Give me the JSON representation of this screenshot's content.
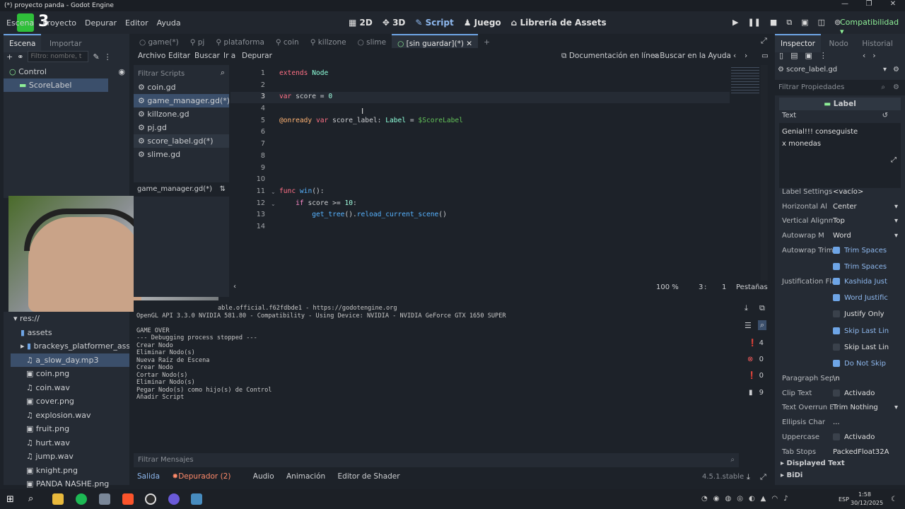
{
  "window": {
    "title": "(*) proyecto panda - Godot Engine"
  },
  "menu": {
    "items": [
      "Escena",
      "Proyecto",
      "Depurar",
      "Editor",
      "Ayuda"
    ],
    "logo_text": "3"
  },
  "workspaces": {
    "items": [
      "2D",
      "3D",
      "Script",
      "Juego",
      "Librería de Assets"
    ],
    "active": "Script"
  },
  "renderer": "Compatibilidad",
  "scene_dock": {
    "tabs": [
      "Escena",
      "Importar"
    ],
    "filter_placeholder": "Filtro: nombre, t",
    "nodes": [
      {
        "label": "Control"
      },
      {
        "label": "ScoreLabel"
      }
    ]
  },
  "editor_tabs": [
    "game(*)",
    "pj",
    "plataforma",
    "coin",
    "killzone",
    "slime",
    "[sin guardar](*)"
  ],
  "script_menu": {
    "items": [
      "Archivo",
      "Editar",
      "Buscar",
      "Ir a",
      "Depurar"
    ],
    "doc_button": "Documentación en línea",
    "help_search": "Buscar en la Ayuda"
  },
  "script_list": {
    "filter_placeholder": "Filtrar Scripts",
    "items": [
      "coin.gd",
      "game_manager.gd(*)",
      "killzone.gd",
      "pj.gd",
      "score_label.gd(*)",
      "slime.gd"
    ],
    "current": "game_manager.gd(*)"
  },
  "code": {
    "line_numbers": [
      "1",
      "2",
      "3",
      "4",
      "5",
      "6",
      "7",
      "8",
      "9",
      "10",
      "11",
      "12",
      "13",
      "14"
    ],
    "zoom": "100 %",
    "cursor_line": "3",
    "cursor_col": "1",
    "indent_mode": "Pestañas"
  },
  "filesystem": {
    "root": "res://",
    "items": [
      "assets",
      "brackeys_platformer_ass...",
      "a_slow_day.mp3",
      "coin.png",
      "coin.wav",
      "cover.png",
      "explosion.wav",
      "fruit.png",
      "hurt.wav",
      "jump.wav",
      "knight.png",
      "PANDA NASHE.png"
    ]
  },
  "output": {
    "lines": [
      "able.official.f62fdbde1 - https://godotengine.org",
      "OpenGL API 3.3.0 NVIDIA 581.80 - Compatibility - Using Device: NVIDIA - NVIDIA GeForce GTX 1650 SUPER",
      "",
      "GAME OVER",
      "--- Debugging process stopped ---",
      "Crear Nodo",
      "Eliminar Nodo(s)",
      "Nueva Raíz de Escena",
      "Crear Nodo",
      "Cortar Nodo(s)",
      "Eliminar Nodo(s)",
      "Pegar Nodo(s) como hijo(s) de Control",
      "Añadir Script"
    ],
    "filter_placeholder": "Filtrar Mensajes",
    "counts": [
      "4",
      "0",
      "0",
      "9"
    ]
  },
  "bottom_tabs": [
    "Salida",
    "Depurador (2)",
    "Audio",
    "Animación",
    "Editor de Shader"
  ],
  "version": "4.5.1.stable",
  "inspector": {
    "tabs": [
      "Inspector",
      "Nodo",
      "Historial"
    ],
    "resource": "score_label.gd",
    "filter_placeholder": "Filtrar Propiedades",
    "class_header": "Label",
    "text_label": "Text",
    "text_value_1": "Genial!!! conseguiste",
    "text_value_2": "x monedas",
    "properties": [
      {
        "label": "Label Settings",
        "value": "<vacío>"
      },
      {
        "label": "Horizontal Al",
        "value": "Center"
      },
      {
        "label": "Vertical Alignme",
        "value": "Top"
      },
      {
        "label": "Autowrap M",
        "value": "Word"
      },
      {
        "label": "Autowrap Trim",
        "value": "Trim Spaces"
      },
      {
        "label": "",
        "value": "Trim Spaces"
      },
      {
        "label": "Justification Fla",
        "value": "Kashida Just"
      },
      {
        "label": "",
        "value": "Word Justific"
      },
      {
        "label": "",
        "value": "Justify Only"
      },
      {
        "label": "",
        "value": "Skip Last Lin"
      },
      {
        "label": "",
        "value": "Skip Last Lin"
      },
      {
        "label": "",
        "value": "Do Not Skip"
      },
      {
        "label": "Paragraph Sepa",
        "value": "\\n"
      },
      {
        "label": "Clip Text",
        "value": "Activado"
      },
      {
        "label": "Text Overrun Be",
        "value": "Trim Nothing"
      },
      {
        "label": "Ellipsis Char",
        "value": "..."
      },
      {
        "label": "Uppercase",
        "value": "Activado"
      },
      {
        "label": "Tab Stops",
        "value": "PackedFloat32A"
      }
    ],
    "sections": [
      "Displayed Text",
      "BiDi"
    ]
  },
  "taskbar": {
    "time": "1:58",
    "date": "30/12/2025",
    "lang": "ESP"
  }
}
